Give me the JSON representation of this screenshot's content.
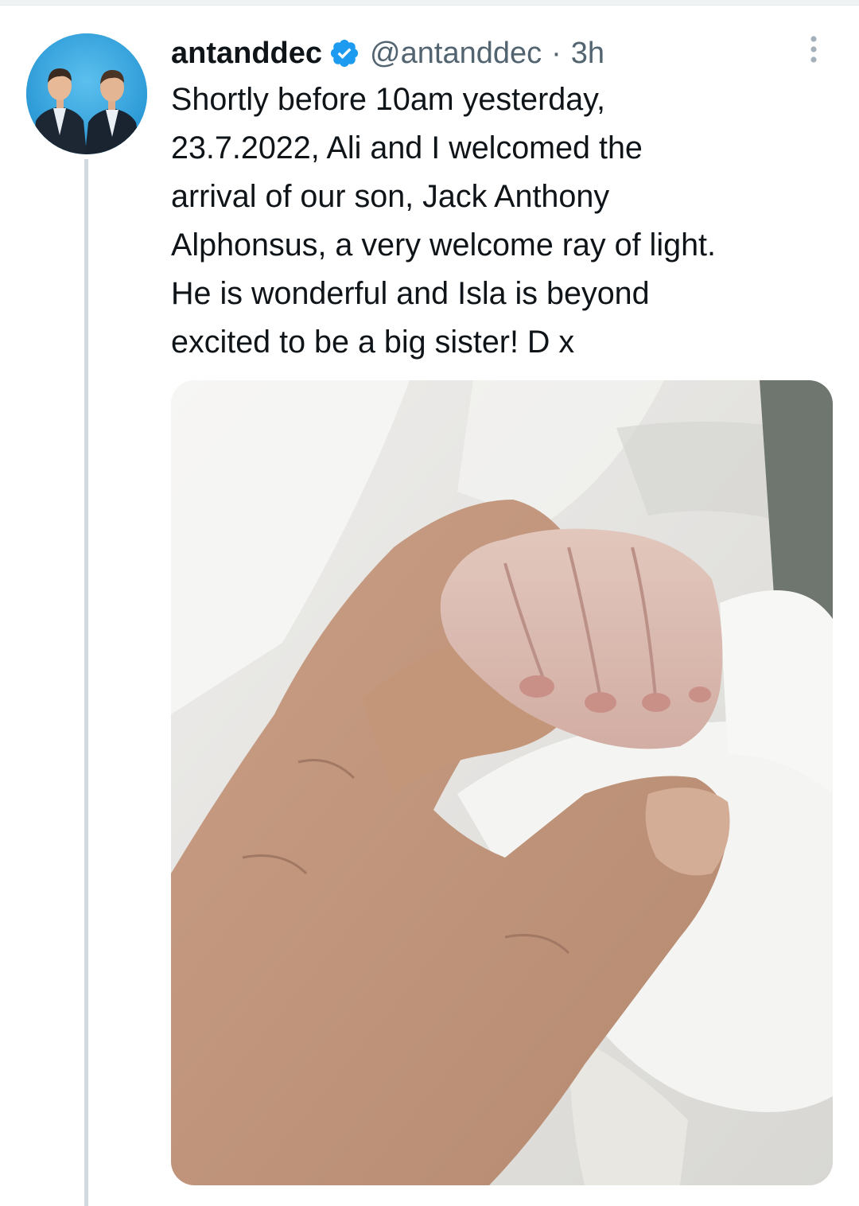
{
  "tweet": {
    "author": {
      "display_name": "antanddec",
      "verified": true,
      "handle": "@antanddec",
      "separator": "·",
      "time": "3h",
      "avatar_icon": "profile-photo-two-men-in-suits"
    },
    "text_lines": [
      "Shortly before 10am yesterday,",
      "23.7.2022, Ali and I welcomed the",
      "arrival of our son, Jack Anthony",
      "Alphonsus, a very welcome ray of light.",
      "He is wonderful and Isla is beyond",
      "excited to be a big sister! D x"
    ],
    "media": {
      "type": "photo"
    },
    "icons": {
      "verified": "verified-badge-icon",
      "more": "more-options-icon"
    }
  },
  "colors": {
    "verified_blue": "#1d9bf0",
    "secondary_text": "#536471",
    "thread_line": "#cfd9de"
  }
}
